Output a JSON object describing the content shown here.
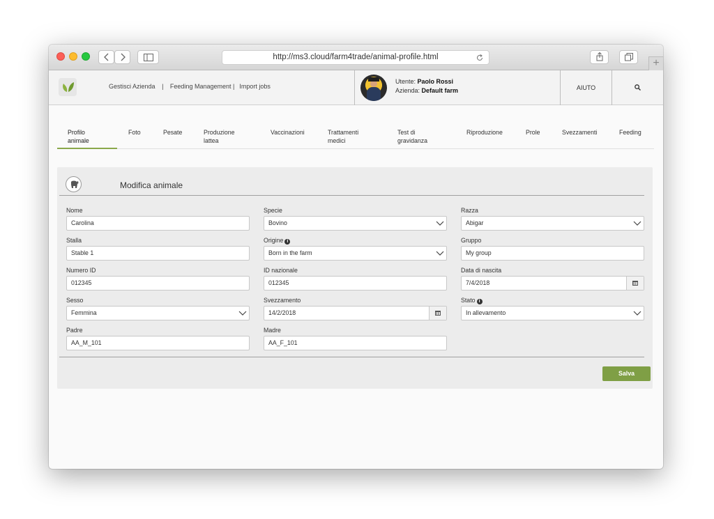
{
  "browser": {
    "url": "http://ms3.cloud/farm4trade/animal-profile.html"
  },
  "app": {
    "nav": {
      "link1": "Gestisci Azienda",
      "sep1": "|",
      "link2": "Feeding Management |",
      "link3": "Import jobs"
    },
    "user": {
      "user_label": "Utente:",
      "user_name": "Paolo Rossi",
      "farm_label": "Azienda:",
      "farm_name": "Default farm"
    },
    "help_label": "AIUTO"
  },
  "tabs": [
    {
      "line1": "Profilo",
      "line2": "animale",
      "active": true
    },
    {
      "line1": "Foto",
      "line2": ""
    },
    {
      "line1": "Pesate",
      "line2": ""
    },
    {
      "line1": "Produzione",
      "line2": "lattea"
    },
    {
      "line1": "Vaccinazioni",
      "line2": ""
    },
    {
      "line1": "Trattamenti",
      "line2": "medici"
    },
    {
      "line1": "Test di",
      "line2": "gravidanza"
    },
    {
      "line1": "Riproduzione",
      "line2": ""
    },
    {
      "line1": "Prole",
      "line2": ""
    },
    {
      "line1": "Svezzamenti",
      "line2": ""
    },
    {
      "line1": "Feeding",
      "line2": ""
    }
  ],
  "form": {
    "title": "Modifica animale",
    "fields": {
      "nome": {
        "label": "Nome",
        "value": "Carolina"
      },
      "specie": {
        "label": "Specie",
        "value": "Bovino"
      },
      "razza": {
        "label": "Razza",
        "value": "Abigar"
      },
      "stalla": {
        "label": "Stalla",
        "value": "Stable 1"
      },
      "origine": {
        "label": "Origine",
        "value": "Born in the farm"
      },
      "gruppo": {
        "label": "Gruppo",
        "value": "My group"
      },
      "numero_id": {
        "label": "Numero ID",
        "value": "012345"
      },
      "id_nazionale": {
        "label": "ID nazionale",
        "value": "012345"
      },
      "data_nascita": {
        "label": "Data di nascita",
        "value": "7/4/2018"
      },
      "sesso": {
        "label": "Sesso",
        "value": "Femmina"
      },
      "svezzamento": {
        "label": "Svezzamento",
        "value": "14/2/2018"
      },
      "stato": {
        "label": "Stato",
        "value": "In allevamento"
      },
      "padre": {
        "label": "Padre",
        "value": "AA_M_101"
      },
      "madre": {
        "label": "Madre",
        "value": "AA_F_101"
      }
    },
    "save_label": "Salva"
  },
  "colors": {
    "accent_green": "#7f9f45",
    "tab_underline": "#8aa84a"
  },
  "icons": [
    "back-icon",
    "forward-icon",
    "sidebar-icon",
    "reload-icon",
    "share-icon",
    "tabs-icon",
    "new-tab-icon",
    "leaf-logo-icon",
    "search-icon",
    "animal-icon",
    "chevron-down-icon",
    "calendar-icon",
    "info-icon"
  ]
}
